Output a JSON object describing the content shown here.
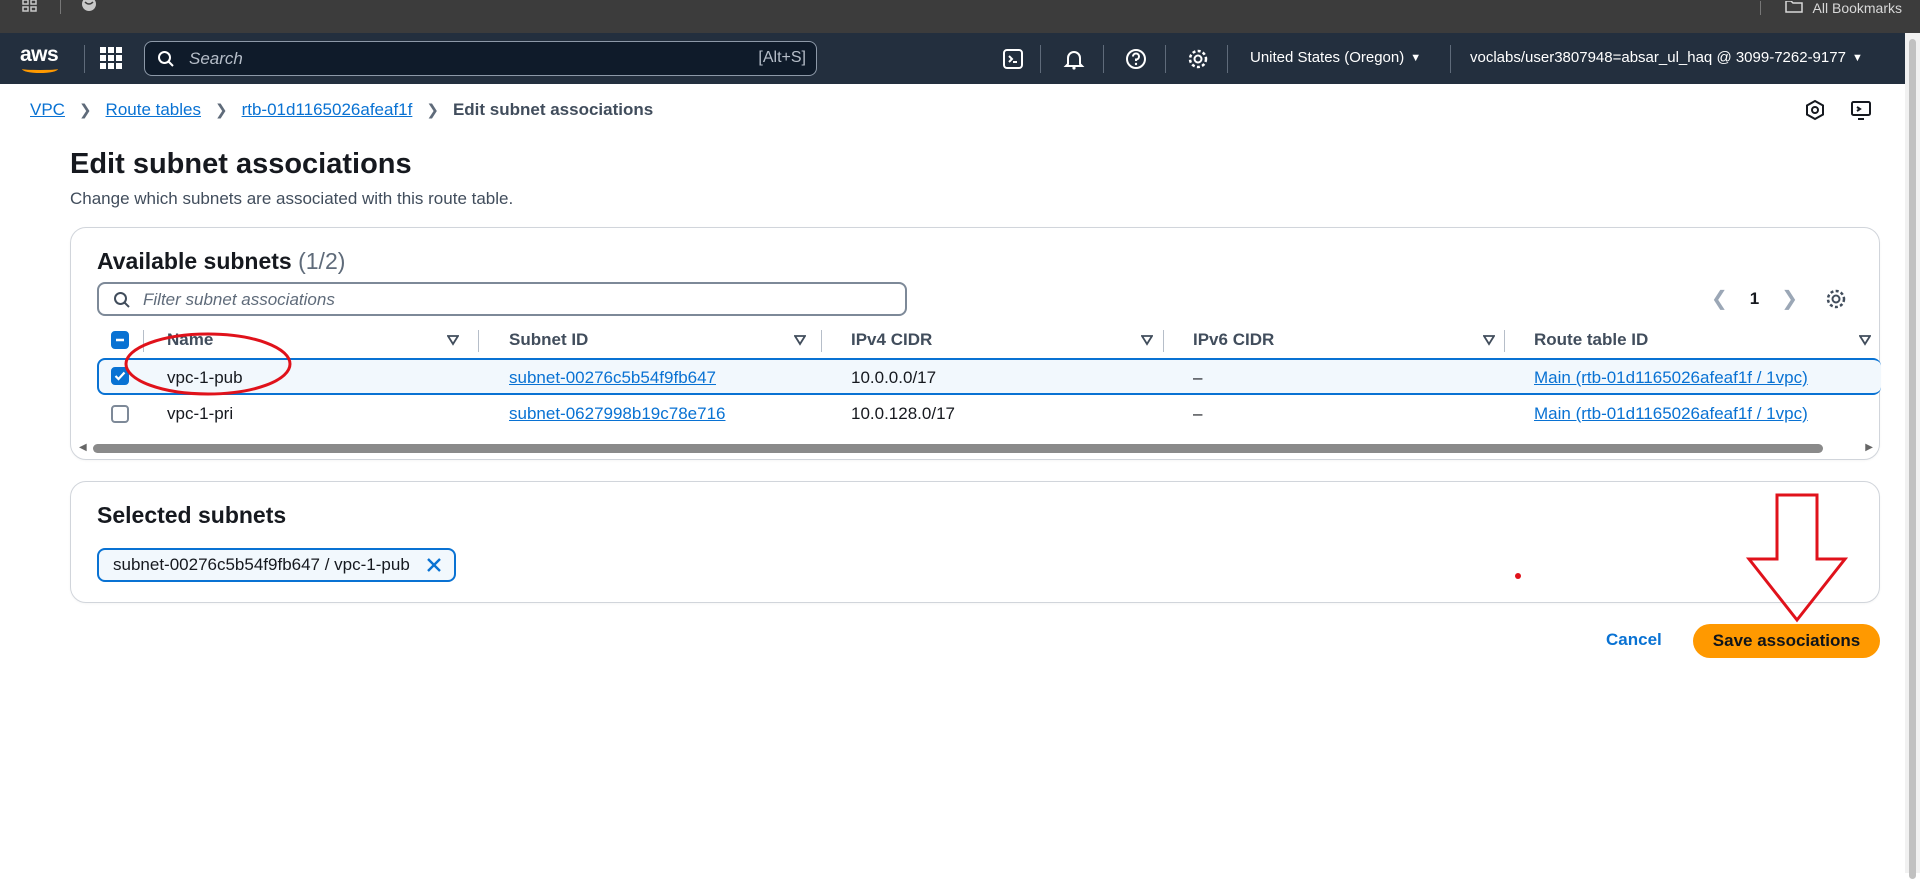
{
  "browser": {
    "bookmarks_label": "All Bookmarks"
  },
  "header": {
    "search_placeholder": "Search",
    "search_shortcut": "[Alt+S]",
    "region": "United States (Oregon)",
    "account": "voclabs/user3807948=absar_ul_haq @ 3099-7262-9177"
  },
  "breadcrumb": {
    "items": [
      "VPC",
      "Route tables",
      "rtb-01d1165026afeaf1f"
    ],
    "current": "Edit subnet associations"
  },
  "page": {
    "title": "Edit subnet associations",
    "description": "Change which subnets are associated with this route table."
  },
  "available": {
    "title": "Available subnets",
    "count": "(1/2)",
    "filter_placeholder": "Filter subnet associations",
    "page": "1",
    "columns": [
      "Name",
      "Subnet ID",
      "IPv4 CIDR",
      "IPv6 CIDR",
      "Route table ID"
    ],
    "rows": [
      {
        "name": "vpc-1-pub",
        "subnet_id": "subnet-00276c5b54f9fb647",
        "ipv4": "10.0.0.0/17",
        "ipv6": "–",
        "route_table": "Main (rtb-01d1165026afeaf1f / 1vpc)",
        "selected": true
      },
      {
        "name": "vpc-1-pri",
        "subnet_id": "subnet-0627998b19c78e716",
        "ipv4": "10.0.128.0/17",
        "ipv6": "–",
        "route_table": "Main (rtb-01d1165026afeaf1f / 1vpc)",
        "selected": false
      }
    ]
  },
  "selected": {
    "title": "Selected subnets",
    "token": "subnet-00276c5b54f9fb647 / vpc-1-pub"
  },
  "actions": {
    "cancel": "Cancel",
    "save": "Save associations"
  },
  "colors": {
    "header_bg": "#232f3e",
    "link": "#0972d3",
    "primary_button": "#ff9900",
    "annotation": "#e0121b"
  }
}
